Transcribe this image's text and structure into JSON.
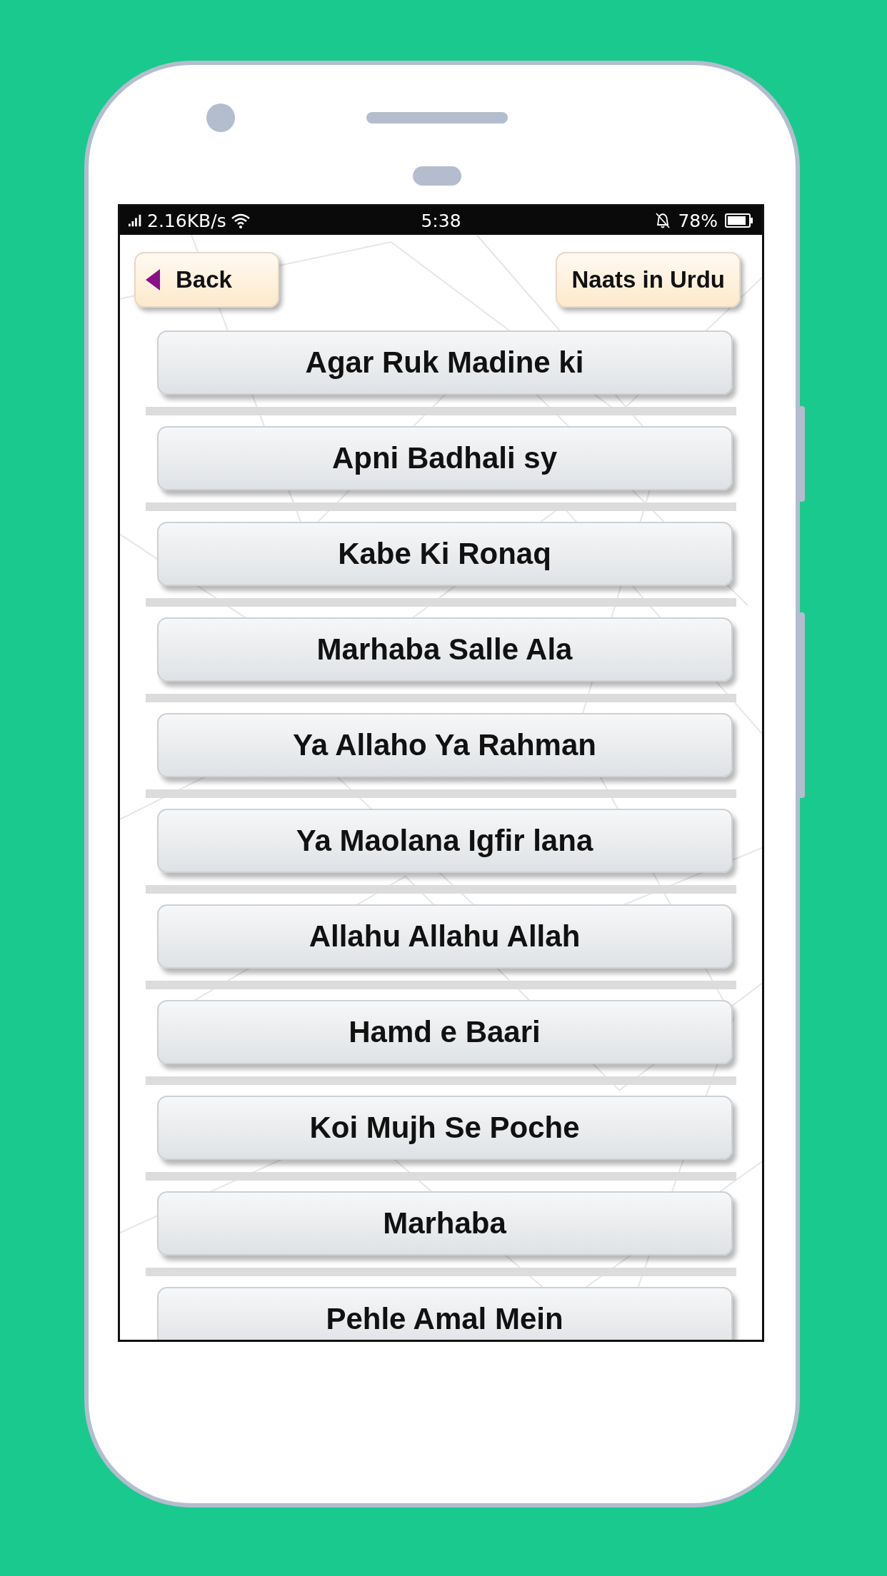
{
  "status_bar": {
    "network_speed": "2.16KB/s",
    "time": "5:38",
    "battery": "78%"
  },
  "header": {
    "back_button": {
      "label": "Back"
    },
    "title_button": {
      "label": "Naats in Urdu"
    }
  },
  "naats": [
    {
      "title": "Agar Ruk Madine ki"
    },
    {
      "title": "Apni Badhali sy"
    },
    {
      "title": "Kabe Ki Ronaq"
    },
    {
      "title": "Marhaba Salle Ala"
    },
    {
      "title": "Ya Allaho Ya Rahman"
    },
    {
      "title": "Ya Maolana Igfir lana"
    },
    {
      "title": "Allahu Allahu Allah"
    },
    {
      "title": "Hamd e Baari"
    },
    {
      "title": "Koi Mujh Se Poche"
    },
    {
      "title": "Marhaba"
    },
    {
      "title": "Pehle Amal Mein"
    }
  ]
}
